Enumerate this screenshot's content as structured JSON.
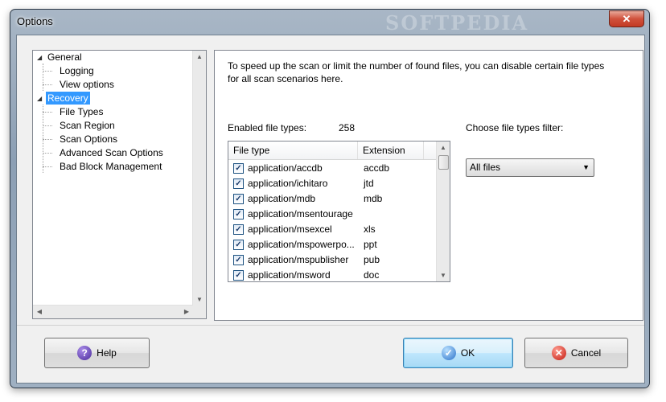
{
  "window": {
    "title": "Options",
    "watermark": "SOFTPEDIA",
    "close_glyph": "✕"
  },
  "tree": {
    "items": [
      {
        "label": "General",
        "level": 0,
        "expander": "◢"
      },
      {
        "label": "Logging",
        "level": 1
      },
      {
        "label": "View options",
        "level": 1
      },
      {
        "label": "Recovery",
        "level": 0,
        "expander": "◢",
        "selected": true
      },
      {
        "label": "File Types",
        "level": 1
      },
      {
        "label": "Scan Region",
        "level": 1
      },
      {
        "label": "Scan Options",
        "level": 1
      },
      {
        "label": "Advanced Scan Options",
        "level": 1
      },
      {
        "label": "Bad Block Management",
        "level": 1
      }
    ]
  },
  "panel": {
    "description": "To speed up the scan or limit the number of found files, you can disable certain file types for all scan scenarios here.",
    "enabled_label": "Enabled file types:",
    "enabled_count": "258",
    "filter_label": "Choose file types filter:",
    "filter_value": "All files",
    "columns": [
      "File type",
      "Extension"
    ],
    "rows": [
      {
        "type": "application/accdb",
        "ext": "accdb",
        "checked": true
      },
      {
        "type": "application/ichitaro",
        "ext": "jtd",
        "checked": true
      },
      {
        "type": "application/mdb",
        "ext": "mdb",
        "checked": true
      },
      {
        "type": "application/msentourage",
        "ext": "",
        "checked": true
      },
      {
        "type": "application/msexcel",
        "ext": "xls",
        "checked": true
      },
      {
        "type": "application/mspowerpo...",
        "ext": "ppt",
        "checked": true
      },
      {
        "type": "application/mspublisher",
        "ext": "pub",
        "checked": true
      },
      {
        "type": "application/msword",
        "ext": "doc",
        "checked": true
      }
    ]
  },
  "buttons": {
    "help": "Help",
    "ok": "OK",
    "cancel": "Cancel"
  },
  "icons": {
    "help": "?",
    "ok": "✓",
    "cancel": "✕"
  }
}
